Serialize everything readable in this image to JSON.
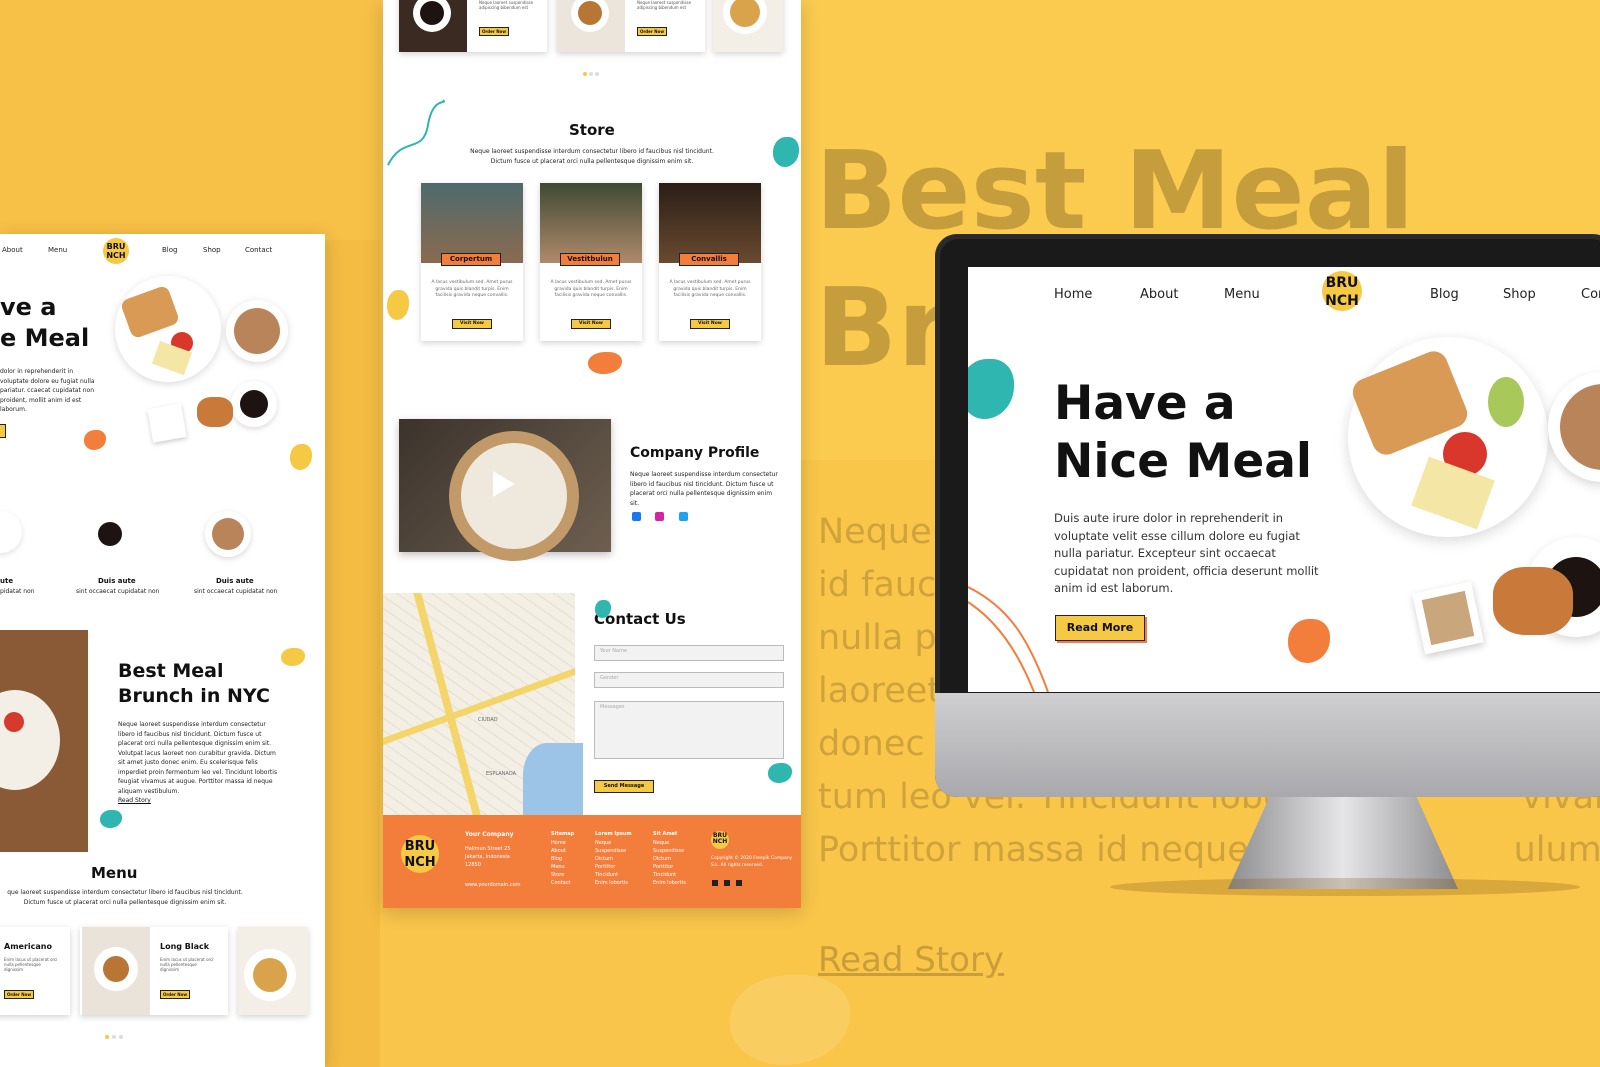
{
  "nav": {
    "home": "Home",
    "about": "About",
    "menu": "Menu",
    "blog": "Blog",
    "shop": "Shop",
    "contact": "Contact",
    "contact_cut": "Con"
  },
  "logo": {
    "line1": "BRU",
    "line2": "NCH"
  },
  "hero": {
    "title_line1": "Have a",
    "title_line2": "Nice Meal",
    "title_cut1": "ve a",
    "title_cut2": "e Meal",
    "body": "Duis aute irure dolor in reprehenderit in voluptate velit esse cillum dolore eu fugiat nulla pariatur. Excepteur sint occaecat cupidatat non proident, officia deserunt mollit anim id est laborum.",
    "body_cut": "dolor in reprehenderit in voluptate dolore eu fugiat nulla pariatur. ccaecat cupidatat non proident, mollit anim id est laborum.",
    "read_more": "Read More"
  },
  "features": [
    {
      "title": "ute",
      "text": "pidatat non"
    },
    {
      "title": "Duis aute",
      "text": "sint occaecat cupidatat non"
    },
    {
      "title": "Duis aute",
      "text": "sint occaecat cupidatat non"
    }
  ],
  "best_meal": {
    "title_line1": "Best Meal",
    "title_line2": "Brunch in NYC",
    "body": "Neque laoreet suspendisse interdum consectetur libero id faucibus nisl tincidunt. Dictum fusce ut placerat orci nulla pellentesque dignissim enim sit. Volutpat lacus laoreet non curabitur gravida. Dictum sit amet justo donec enim. Eu scelerisque felis imperdiet proin fermentum leo vel. Tincidunt lobortis feugiat vivamus at augue. Porttitor massa id neque aliquam vestibulum.",
    "read_story": "Read Story"
  },
  "menu_section": {
    "title": "Menu",
    "intro": "que laoreet suspendisse interdum consectetur libero id faucibus nisl tincidunt. Dictum fusce ut placerat orci nulla pellentesque dignissim enim sit.",
    "items": [
      {
        "name": "Americano",
        "text": "Enim lacus ut placerat orci nulla pellentesque dignissim",
        "button": "Order Now"
      },
      {
        "name": "Long Black",
        "text": "Enim lacus ut placerat orci nulla pellentesque dignissim",
        "button": "Order Now"
      }
    ]
  },
  "top_cards": {
    "button": "Order Now",
    "text": "Neque laoreet suspendisse adipiscing bibendum est"
  },
  "store": {
    "title": "Store",
    "intro": "Neque laoreet suspendisse interdum consectetur libero id faucibus nisl tincidunt. Dictum fusce ut placerat orci nulla pellentesque dignissim enim sit.",
    "items": [
      {
        "label": "Corpertum",
        "text": "A lacus vestibulum sed. Amet purus gravida quis blandit turpis. Enim facilisis gravida neque convallis.",
        "button": "Visit Now"
      },
      {
        "label": "Vestitbulun",
        "text": "A lacus vestibulum sed. Amet purus gravida quis blandit turpis. Enim facilisis gravida neque convallis.",
        "button": "Visit Now"
      },
      {
        "label": "Convallis",
        "text": "A lacus vestibulum sed. Amet purus gravida quis blandit turpis. Enim facilisis gravida neque convallis.",
        "button": "Visit Now"
      }
    ]
  },
  "profile": {
    "title": "Company Profile",
    "body": "Neque laoreet suspendisse interdum consectetur libero id faucibus nisl tincidunt. Dictum fusce ut placerat orci nulla pellentesque dignissim enim sit."
  },
  "contact": {
    "title": "Contact Us",
    "name_placeholder": "Your Name",
    "gender_placeholder": "Gender",
    "message_placeholder": "Messages",
    "send": "Send Message",
    "map_label": "CIUDAD",
    "map_label2": "ESPLANADA"
  },
  "footer": {
    "company": {
      "title": "Your Company",
      "lines": [
        "Halimun Street 25",
        "Jakarta, Indonesia",
        "12850"
      ],
      "domain": "www.yourdomain.com"
    },
    "sitemap": {
      "title": "Sitemap",
      "items": [
        "Home",
        "About",
        "Blog",
        "Menu",
        "Store",
        "Contact"
      ]
    },
    "lorem": {
      "title": "Lorem Ipsum",
      "items": [
        "Neque",
        "Suspendisse",
        "Dictum",
        "Porttitor",
        "Tincidunt",
        "Enim lobortis"
      ]
    },
    "sit": {
      "title": "Sit Amet",
      "items": [
        "Neque",
        "Suspendisse",
        "Dictum",
        "Porttitor",
        "Tincidunt",
        "Enim lobortis"
      ]
    },
    "copyright": "Copyright © 2020 Freepik Company S.L. All rights reserved."
  },
  "ghost": {
    "line1": "Best Meal",
    "line2": "Br",
    "text_lines": [
      "Neque",
      "id fauci",
      "nulla pe",
      "laoreet",
      "donec e",
      "tum leo vel. Tincidunt lobor                    vivamus at",
      "Porttitor massa id neque al                    ulum."
    ],
    "read_story": "Read Story"
  },
  "colors": {
    "yellow": "#f6c945",
    "orange": "#f37e3c",
    "teal": "#2fb6b0",
    "background": "#f9c54a"
  }
}
